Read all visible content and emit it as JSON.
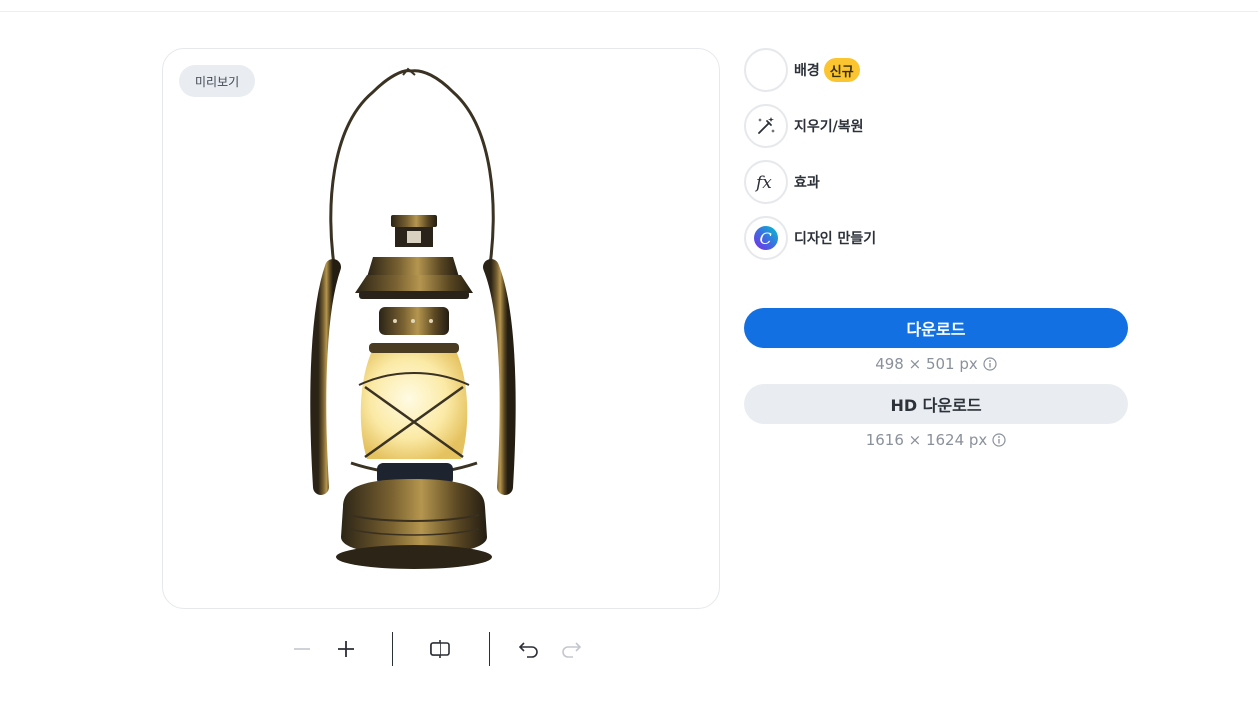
{
  "preview": {
    "badge": "미리보기",
    "image_alt": "lantern"
  },
  "toolbar": {
    "icons": [
      "minus-icon",
      "plus-icon",
      "compare-icon",
      "undo-icon",
      "redo-icon"
    ]
  },
  "tools": [
    {
      "label": "배경",
      "badge": "신규",
      "icon": "background-swatch-icon"
    },
    {
      "label": "지우기/복원",
      "icon": "magic-brush-icon"
    },
    {
      "label": "효과",
      "icon": "fx-icon"
    },
    {
      "label": "디자인 만들기",
      "icon": "canva-logo-icon"
    }
  ],
  "downloads": {
    "download_label": "다운로드",
    "download_size": "498 × 501 px",
    "hd_label": "HD 다운로드",
    "hd_size": "1616 × 1624 px"
  },
  "colors": {
    "primary": "#1270e3",
    "new_badge": "#fbc531",
    "secondary_button": "#e9edf1"
  }
}
